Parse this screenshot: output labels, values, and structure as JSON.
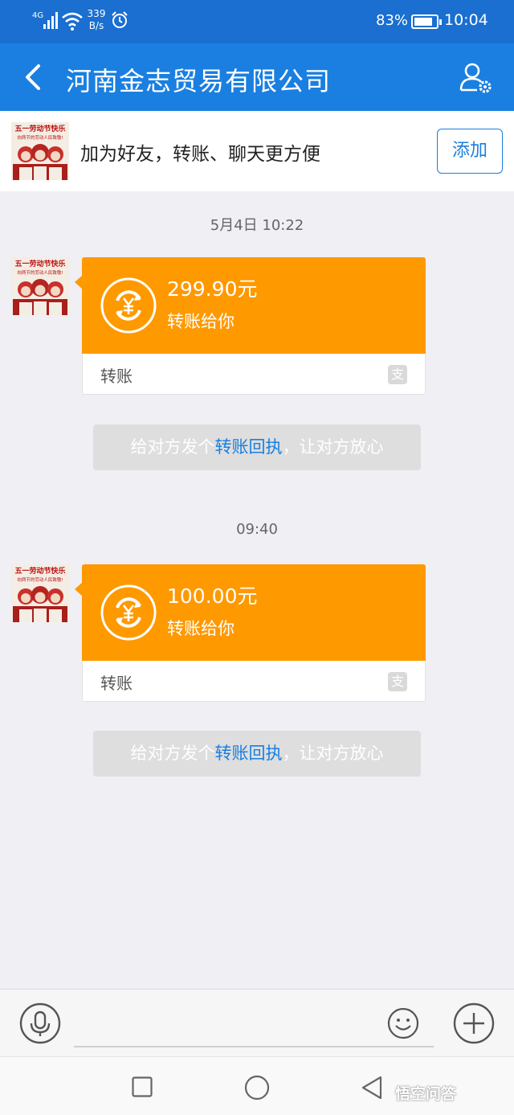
{
  "status_bar": {
    "network": "4G",
    "speed_value": "339",
    "speed_unit": "B/s",
    "battery": "83%",
    "time": "10:04"
  },
  "header": {
    "title": "河南金志贸易有限公司",
    "back_icon": "chevron-left-icon",
    "profile_icon": "user-settings-icon"
  },
  "banner": {
    "avatar_icon": "may-day-poster-avatar",
    "avatar_text_line1": "五一劳动节快乐",
    "avatar_text_line2": "向两节的劳动人民致敬!",
    "text": "加为好友，转账、聊天更方便",
    "add_label": "添加"
  },
  "messages": [
    {
      "timestamp": "5月4日 10:22",
      "amount": "299.90元",
      "desc": "转账给你",
      "label": "转账",
      "app_icon_text": "支",
      "receipt_prefix": "给对方发个",
      "receipt_link": "转账回执",
      "receipt_suffix": "，让对方放心"
    },
    {
      "timestamp": "09:40",
      "amount": "100.00元",
      "desc": "转账给你",
      "label": "转账",
      "app_icon_text": "支",
      "receipt_prefix": "给对方发个",
      "receipt_link": "转账回执",
      "receipt_suffix": "，让对方放心"
    }
  ],
  "input_bar": {
    "voice_icon": "microphone-icon",
    "emoji_icon": "smiley-icon",
    "plus_icon": "plus-icon"
  },
  "nav_bar": {
    "recent_icon": "square-icon",
    "home_icon": "circle-icon",
    "back_icon": "triangle-back-icon"
  },
  "watermark": "悟空问答",
  "colors": {
    "status_bar": "#1a6fd0",
    "header": "#1a7fe0",
    "transfer_card": "#ff9900",
    "link": "#1a7fe0",
    "background": "#efeff4"
  }
}
